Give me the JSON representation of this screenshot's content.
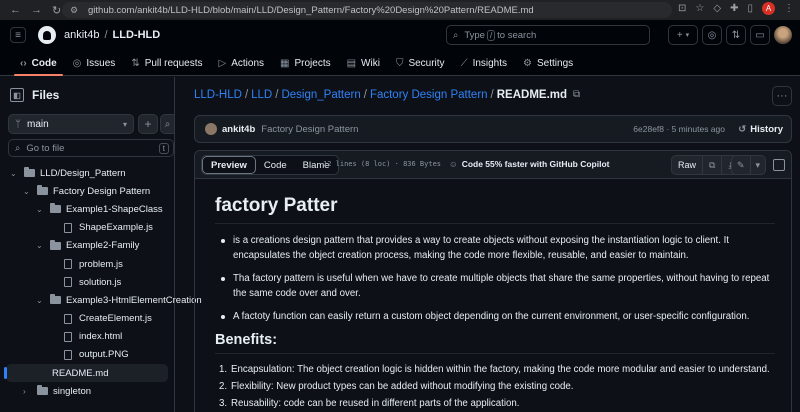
{
  "browser": {
    "url": "github.com/ankit4b/LLD-HLD/blob/main/LLD/Design_Pattern/Factory%20Design%20Pattern/README.md",
    "profile_letter": "A"
  },
  "header": {
    "owner": "ankit4b",
    "repo": "LLD-HLD",
    "search_before": "Type",
    "search_key": "/",
    "search_after": "to search",
    "add_label": "+"
  },
  "repo_nav": {
    "tabs": [
      {
        "label": "Code",
        "icon": "code-icon"
      },
      {
        "label": "Issues",
        "icon": "issue-icon"
      },
      {
        "label": "Pull requests",
        "icon": "pull-request-icon"
      },
      {
        "label": "Actions",
        "icon": "play-icon"
      },
      {
        "label": "Projects",
        "icon": "table-icon"
      },
      {
        "label": "Wiki",
        "icon": "book-icon"
      },
      {
        "label": "Security",
        "icon": "shield-icon"
      },
      {
        "label": "Insights",
        "icon": "graph-icon"
      },
      {
        "label": "Settings",
        "icon": "gear-icon"
      }
    ],
    "active": "Code"
  },
  "sidebar": {
    "title": "Files",
    "branch": "main",
    "goto_placeholder": "Go to file",
    "goto_key": "t",
    "tree": [
      {
        "label": "LLD/Design_Pattern",
        "depth": 0,
        "type": "folder",
        "open": true
      },
      {
        "label": "Factory Design Pattern",
        "depth": 1,
        "type": "folder",
        "open": true
      },
      {
        "label": "Example1-ShapeClass",
        "depth": 2,
        "type": "folder",
        "open": true
      },
      {
        "label": "ShapeExample.js",
        "depth": 3,
        "type": "file"
      },
      {
        "label": "Example2-Family",
        "depth": 2,
        "type": "folder",
        "open": true
      },
      {
        "label": "problem.js",
        "depth": 3,
        "type": "file"
      },
      {
        "label": "solution.js",
        "depth": 3,
        "type": "file"
      },
      {
        "label": "Example3-HtmlElementCreation",
        "depth": 2,
        "type": "folder",
        "open": true
      },
      {
        "label": "CreateElement.js",
        "depth": 3,
        "type": "file"
      },
      {
        "label": "index.html",
        "depth": 3,
        "type": "file"
      },
      {
        "label": "output.PNG",
        "depth": 3,
        "type": "file"
      },
      {
        "label": "README.md",
        "depth": 2,
        "type": "file",
        "selected": true
      },
      {
        "label": "singleton",
        "depth": 1,
        "type": "folder",
        "open": false
      }
    ]
  },
  "breadcrumb": {
    "parts": [
      "LLD-HLD",
      "LLD",
      "Design_Pattern",
      "Factory Design Pattern"
    ],
    "current": "README.md"
  },
  "commit": {
    "author": "ankit4b",
    "message": "Factory Design Pattern",
    "sha": "6e28ef8",
    "time": "5 minutes ago",
    "history_label": "History"
  },
  "file_toolbar": {
    "tabs": [
      "Preview",
      "Code",
      "Blame"
    ],
    "active_tab": "Preview",
    "meta": "12 lines (8 loc) · 836 Bytes",
    "copilot": "Code 55% faster with GitHub Copilot",
    "raw_label": "Raw"
  },
  "readme": {
    "title": "factory Patter",
    "bullets": [
      "is a creations design pattern that provides a way to create objects without exposing the instantiation logic to client. It encapsulates the object creation process, making the code more flexible, reusable, and easier to maintain.",
      "Tha factory pattern is useful when we have to create multiple objects that share the same properties, without having to repeat the same code over and over.",
      "A factoty function can easily return a custom object depending on the current environment, or user-specific configuration."
    ],
    "benefits_title": "Benefits:",
    "benefits": [
      "Encapsulation: The object creation logic is hidden within the factory, making the code more modular and easier to understand.",
      "Flexibility: New product types can be added without modifying the existing code.",
      "Reusability: code can be reused in different parts of the application."
    ]
  },
  "colors": {
    "background": "#0d1117",
    "header": "#010409",
    "border": "#30363d",
    "link": "#2f81f7",
    "active_tab_underline": "#f78166",
    "text": "#e6edf3",
    "muted": "#8b949e"
  }
}
